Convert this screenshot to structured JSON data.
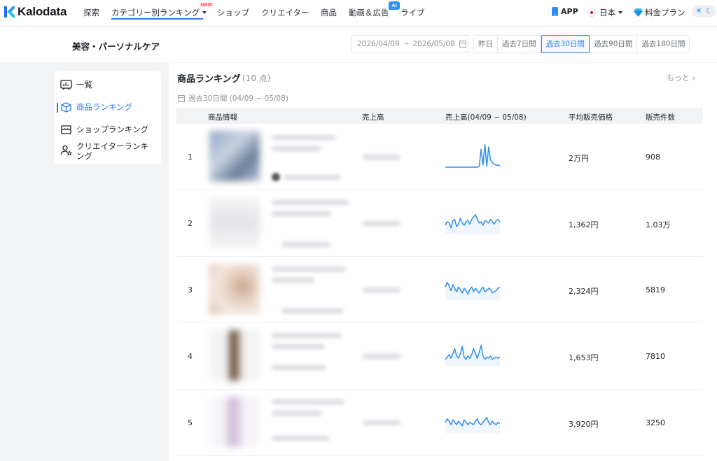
{
  "brand": {
    "name": "Kalodata"
  },
  "nav": {
    "items": [
      "探索",
      "カテゴリー別ランキング",
      "ショップ",
      "クリエイター",
      "商品",
      "動画＆広告",
      "ライブ"
    ],
    "new_badge": "NEW",
    "ai_badge": "AI"
  },
  "header_right": {
    "app": "APP",
    "country": "日本",
    "pricing": "料金プラン"
  },
  "page": {
    "title": "美容・パーソナルケア",
    "date_from": "2026/04/09",
    "date_to": "2026/05/08",
    "range_tabs": [
      "昨日",
      "過去7日間",
      "過去30日間",
      "過去90日間",
      "過去180日間"
    ],
    "active_range": "過去30日間"
  },
  "sidebar": {
    "items": [
      {
        "label": "一覧",
        "icon": "chart-board-icon"
      },
      {
        "label": "商品ランキング",
        "icon": "box-icon"
      },
      {
        "label": "ショップランキング",
        "icon": "shop-icon"
      },
      {
        "label": "クリエイターランキング",
        "icon": "creator-icon"
      }
    ],
    "active": "商品ランキング"
  },
  "ranking": {
    "title": "商品ランキング",
    "count": "(10 点)",
    "more": "もっと",
    "period": "過去30日間 (04/09 ~ 05/08)",
    "columns": [
      "商品情報",
      "売上高",
      "売上高(04/09 ~ 05/08)",
      "平均販売価格",
      "販売件数"
    ],
    "rows": [
      {
        "rank": "1",
        "avg_price": "2万円",
        "units": "908",
        "trend": [
          0,
          0,
          0,
          0,
          0,
          0,
          0,
          0,
          0,
          0,
          0,
          0,
          0,
          0,
          0,
          0,
          0,
          0,
          0.05,
          0.75,
          0.1,
          0.95,
          0.05,
          0.85,
          0.3,
          0.2,
          0.12,
          0.08,
          0.1,
          0.05
        ]
      },
      {
        "rank": "2",
        "avg_price": "1,362円",
        "units": "1.03万",
        "trend": [
          0.35,
          0.5,
          0.45,
          0.25,
          0.55,
          0.6,
          0.3,
          0.4,
          0.65,
          0.45,
          0.35,
          0.5,
          0.55,
          0.4,
          0.6,
          0.7,
          0.8,
          0.6,
          0.45,
          0.5,
          0.35,
          0.55,
          0.5,
          0.45,
          0.6,
          0.5,
          0.4,
          0.55,
          0.6,
          0.5
        ]
      },
      {
        "rank": "3",
        "avg_price": "2,324円",
        "units": "5819",
        "trend": [
          0.55,
          0.75,
          0.6,
          0.4,
          0.65,
          0.5,
          0.35,
          0.55,
          0.45,
          0.3,
          0.5,
          0.4,
          0.25,
          0.45,
          0.55,
          0.35,
          0.5,
          0.4,
          0.3,
          0.45,
          0.55,
          0.35,
          0.4,
          0.5,
          0.45,
          0.3,
          0.35,
          0.4,
          0.5,
          0.55
        ]
      },
      {
        "rank": "4",
        "avg_price": "1,653円",
        "units": "7810",
        "trend": [
          0.3,
          0.4,
          0.5,
          0.35,
          0.55,
          0.75,
          0.45,
          0.35,
          0.55,
          0.85,
          0.4,
          0.3,
          0.45,
          0.35,
          0.5,
          0.75,
          0.55,
          0.35,
          0.6,
          0.9,
          0.45,
          0.3,
          0.4,
          0.35,
          0.45,
          0.3,
          0.35,
          0.4,
          0.35,
          0.4
        ]
      },
      {
        "rank": "5",
        "avg_price": "3,920円",
        "units": "3250",
        "trend": [
          0.45,
          0.6,
          0.5,
          0.35,
          0.55,
          0.45,
          0.35,
          0.5,
          0.4,
          0.3,
          0.55,
          0.45,
          0.35,
          0.45,
          0.4,
          0.35,
          0.5,
          0.6,
          0.4,
          0.35,
          0.45,
          0.55,
          0.65,
          0.45,
          0.35,
          0.5,
          0.4,
          0.35,
          0.45,
          0.4
        ]
      }
    ]
  },
  "colors": {
    "accent": "#2e7ee6",
    "sparkline": "#2e8ff0",
    "new_badge": "#ff4d4f"
  }
}
